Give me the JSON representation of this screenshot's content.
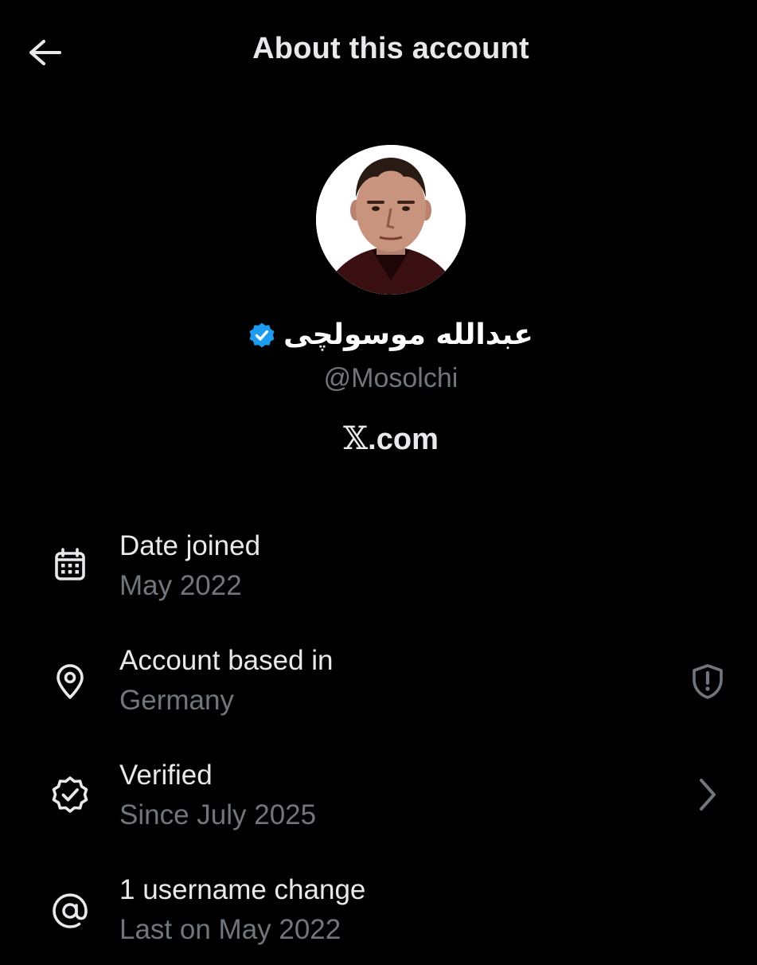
{
  "header": {
    "title": "About this account",
    "back_icon": "arrow-left-icon"
  },
  "profile": {
    "display_name": "عبدالله موسولچی",
    "handle": "@Mosolchi",
    "verified": true,
    "verified_color": "#1d9bf0",
    "platform_x": "𝕏",
    "platform_suffix": ".com"
  },
  "info": [
    {
      "icon": "calendar-icon",
      "label": "Date joined",
      "value": "May 2022"
    },
    {
      "icon": "location-pin-icon",
      "label": "Account based in",
      "value": "Germany",
      "trailing_icon": "shield-alert-icon"
    },
    {
      "icon": "verified-badge-outline-icon",
      "label": "Verified",
      "value": "Since July 2025",
      "trailing_icon": "chevron-right-icon"
    },
    {
      "icon": "at-sign-icon",
      "label": "1 username change",
      "value": "Last on May 2022"
    }
  ],
  "colors": {
    "background": "#000000",
    "primary_text": "#e7e9ea",
    "secondary_text": "#71767b",
    "accent": "#1d9bf0"
  }
}
